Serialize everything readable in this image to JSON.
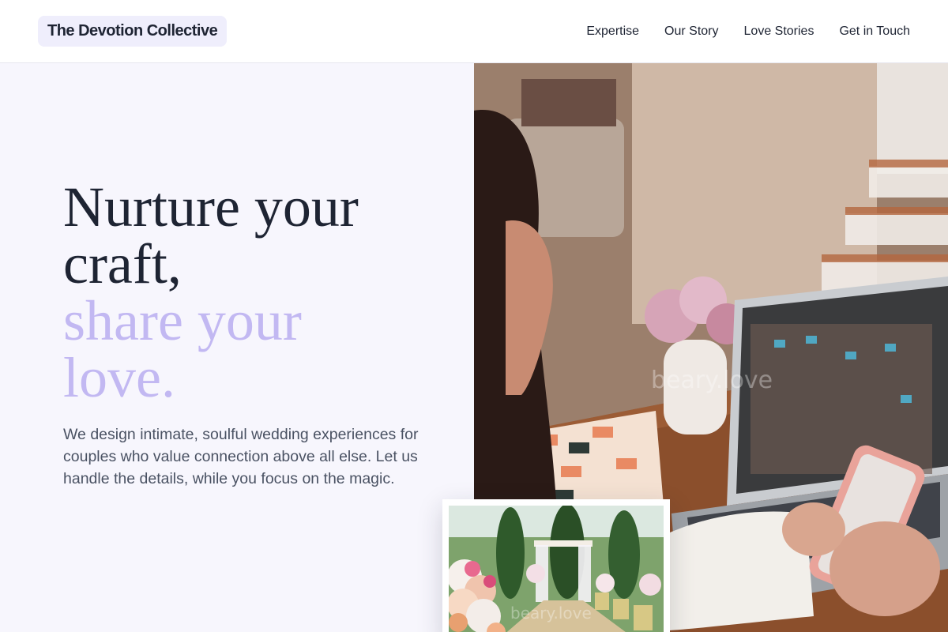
{
  "header": {
    "brand": "The Devotion Collective",
    "nav": [
      {
        "label": "Expertise"
      },
      {
        "label": "Our Story"
      },
      {
        "label": "Love Stories"
      },
      {
        "label": "Get in Touch"
      }
    ]
  },
  "hero": {
    "headline_line1": "Nurture your",
    "headline_line2": "craft,",
    "headline_accent_line1": "share your",
    "headline_accent_line2": "love.",
    "lede": "We design intimate, soulful wedding experiences for couples who value connection above all else. Let us handle the details, while you focus on the magic.",
    "image_watermark": "beary.love",
    "inset_watermark": "beary.love"
  },
  "colors": {
    "accent": "#c2b8f2",
    "brand_bg": "#efeefc",
    "hero_bg": "#f7f6fd",
    "text_dark": "#1e2433",
    "text_muted": "#4a5263"
  },
  "icons": {
    "hero_image": "woman-with-phone-and-laptop-photo",
    "inset_image": "wedding-ceremony-flowers-photo"
  }
}
